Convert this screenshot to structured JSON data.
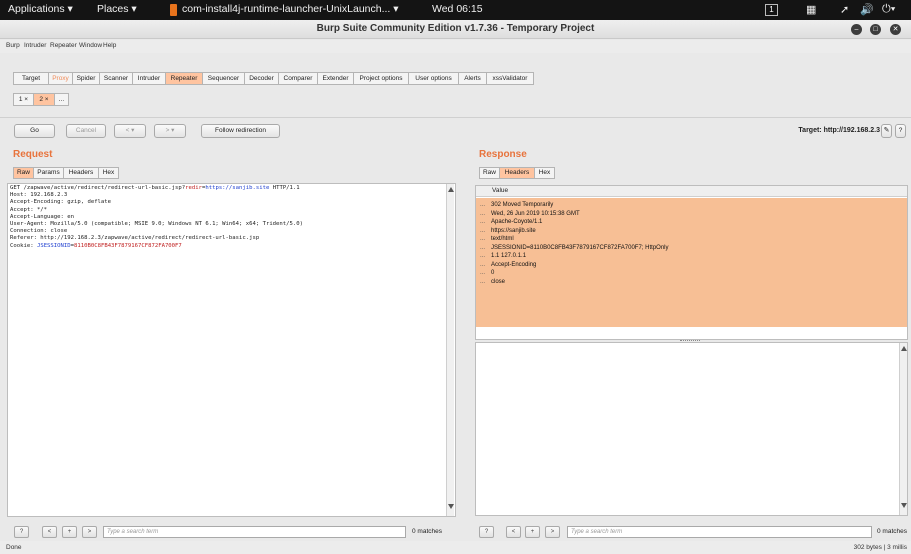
{
  "system_bar": {
    "applications": "Applications ▾",
    "places": "Places ▾",
    "window_app": "com-install4j-runtime-launcher-UnixLaunch... ▾",
    "clock": "Wed 06:15",
    "workspace": "1"
  },
  "window": {
    "title": "Burp Suite Community Edition v1.7.36 - Temporary Project"
  },
  "menu": [
    "Burp",
    "Intruder",
    "Repeater",
    "Window",
    "Help"
  ],
  "main_tabs": [
    "Target",
    "Proxy",
    "Spider",
    "Scanner",
    "Intruder",
    "Repeater",
    "Sequencer",
    "Decoder",
    "Comparer",
    "Extender",
    "Project options",
    "User options",
    "Alerts",
    "xssValidator"
  ],
  "active_main_tab": "Repeater",
  "repeater_tabs": [
    "1 ×",
    "2 ×",
    "..."
  ],
  "toolbar": {
    "go": "Go",
    "cancel": "Cancel",
    "back": "< ▾",
    "forward": "> ▾",
    "follow": "Follow redirection",
    "target_label": "Target: http://192.168.2.3"
  },
  "request": {
    "title": "Request",
    "tabs": [
      "Raw",
      "Params",
      "Headers",
      "Hex"
    ],
    "line1_prefix": "GET /zapwave/active/redirect/redirect-url-basic.jsp?",
    "line1_param": "redir",
    "line1_eq": "=",
    "line1_value": "https://sanjib.site",
    "line1_suffix": " HTTP/1.1",
    "lines": [
      "Host: 192.168.2.3",
      "Accept-Encoding: gzip, deflate",
      "Accept: */*",
      "Accept-Language: en",
      "User-Agent: Mozilla/5.0 (compatible; MSIE 9.0; Windows NT 6.1; Win64; x64; Trident/5.0)",
      "Connection: close",
      "Referer: http://192.168.2.3/zapwave/active/redirect/redirect-url-basic.jsp"
    ],
    "cookie_prefix": "Cookie: ",
    "cookie_name": "JSESSIONID",
    "cookie_eq": "=",
    "cookie_value": "8110B0C8FB43F7879167CF872FA700F7"
  },
  "response": {
    "title": "Response",
    "tabs": [
      "Raw",
      "Headers",
      "Hex"
    ],
    "column": "Value",
    "rows": [
      "302 Moved Temporarily",
      "Wed, 26 Jun 2019 10:15:38 GMT",
      "Apache-Coyote/1.1",
      "https://sanjib.site",
      "text/html",
      "JSESSIONID=8110B0C8FB43F7879167CF872FA700F7; HttpOnly",
      "1.1 127.0.1.1",
      "Accept-Encoding",
      "0",
      "close"
    ],
    "row_dots": "..."
  },
  "search": {
    "help": "?",
    "prev": "<",
    "add": "+",
    "next": ">",
    "placeholder": "Type a search term",
    "left_matches": "0 matches",
    "right_matches": "0 matches"
  },
  "status": {
    "left": "Done",
    "right": "302 bytes | 3 millis"
  },
  "colors": {
    "accent": "#e8733c",
    "active_tab": "#ffc4a0",
    "highlight": "#f7bf95"
  }
}
